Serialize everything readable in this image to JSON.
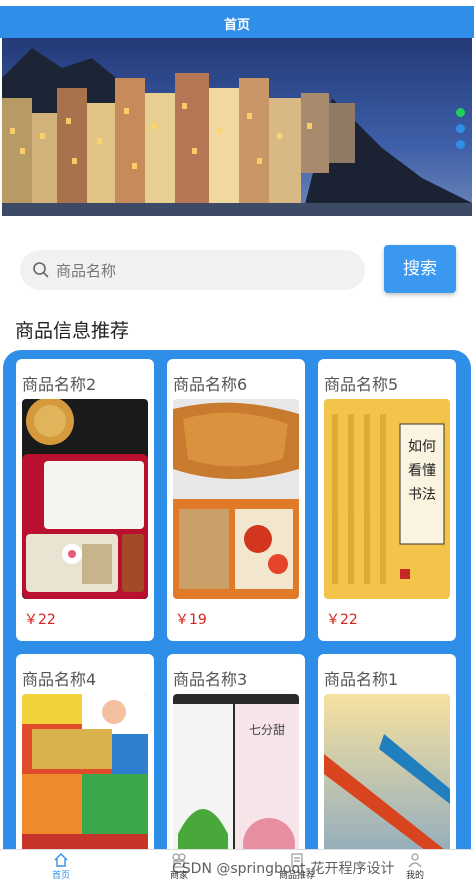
{
  "header": {
    "title": "首页"
  },
  "carousel": {
    "slides": 3,
    "active_index": 0
  },
  "search": {
    "placeholder": "商品名称",
    "button_label": "搜索"
  },
  "section": {
    "title": "商品信息推荐"
  },
  "products": [
    {
      "name": "商品名称2",
      "price": "￥22",
      "image": "bento-box-photo"
    },
    {
      "name": "商品名称6",
      "price": "￥19",
      "image": "fried-chicken-photo"
    },
    {
      "name": "商品名称5",
      "price": "￥22",
      "image": "calligraphy-book-photo"
    },
    {
      "name": "商品名称4",
      "price": "",
      "image": "snacks-photo"
    },
    {
      "name": "商品名称3",
      "price": "",
      "image": "face-mask-packs-photo"
    },
    {
      "name": "商品名称1",
      "price": "",
      "image": "kayaks-photo"
    }
  ],
  "tabbar": {
    "items": [
      {
        "label": "首页",
        "icon": "home-icon",
        "active": true
      },
      {
        "label": "商家",
        "icon": "store-icon",
        "active": false
      },
      {
        "label": "商品推荐",
        "icon": "recommend-icon",
        "active": false
      },
      {
        "label": "我的",
        "icon": "user-icon",
        "active": false
      }
    ]
  },
  "watermark": "CSDN @springboot-花开程序设计",
  "colors": {
    "primary": "#2f8fe8",
    "price": "#d8231b",
    "active_dot": "#1fd15a"
  }
}
